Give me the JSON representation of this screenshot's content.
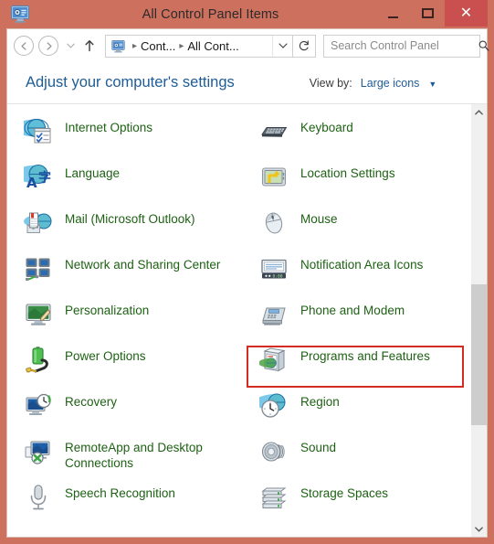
{
  "window": {
    "title": "All Control Panel Items",
    "icon": "control-panel-icon",
    "titlebar_color": "#cd705e",
    "close_button_color": "#c9504e",
    "caption_buttons": {
      "minimize": "–",
      "maximize": "▭",
      "close": "✕"
    }
  },
  "navbar": {
    "back": "back-arrow",
    "forward": "forward-arrow",
    "history": "recent-pages-dropdown",
    "up": "up-one-level",
    "address": {
      "icon": "control-panel-icon",
      "crumbs": [
        "Cont...",
        "All Cont..."
      ],
      "separator": "▸",
      "dropdown": "∨"
    },
    "refresh": "↻",
    "search": {
      "placeholder": "Search Control Panel",
      "value": "",
      "icon": "search-icon"
    }
  },
  "header": {
    "title": "Adjust your computer's settings",
    "view_by_label": "View by:",
    "view_by_value": "Large icons",
    "view_by_caret": "▼"
  },
  "items": {
    "left": [
      {
        "label": "Internet Options",
        "icon": "internet-options-icon"
      },
      {
        "label": "Language",
        "icon": "language-icon"
      },
      {
        "label": "Mail (Microsoft Outlook)",
        "icon": "mail-icon"
      },
      {
        "label": "Network and Sharing Center",
        "icon": "network-sharing-center-icon"
      },
      {
        "label": "Personalization",
        "icon": "personalization-icon"
      },
      {
        "label": "Power Options",
        "icon": "power-options-icon"
      },
      {
        "label": "Recovery",
        "icon": "recovery-icon"
      },
      {
        "label": "RemoteApp and Desktop Connections",
        "icon": "remoteapp-desktop-connections-icon"
      },
      {
        "label": "Speech Recognition",
        "icon": "speech-recognition-icon"
      }
    ],
    "right": [
      {
        "label": "Keyboard",
        "icon": "keyboard-icon"
      },
      {
        "label": "Location Settings",
        "icon": "location-settings-icon"
      },
      {
        "label": "Mouse",
        "icon": "mouse-icon"
      },
      {
        "label": "Notification Area Icons",
        "icon": "notification-area-icons-icon"
      },
      {
        "label": "Phone and Modem",
        "icon": "phone-and-modem-icon"
      },
      {
        "label": "Programs and Features",
        "icon": "programs-and-features-icon",
        "highlighted": true
      },
      {
        "label": "Region",
        "icon": "region-icon"
      },
      {
        "label": "Sound",
        "icon": "sound-icon"
      },
      {
        "label": "Storage Spaces",
        "icon": "storage-spaces-icon"
      }
    ]
  },
  "highlight": {
    "target": "Programs and Features",
    "color": "#d42b22"
  },
  "scrollbar": {
    "up_arrow": "∧",
    "down_arrow": "∨",
    "thumb_position_pct": 41,
    "thumb_size_pct": 35
  },
  "colors": {
    "item_label": "#1e6114",
    "page_title": "#1d5c96",
    "link": "#1d5c96"
  }
}
